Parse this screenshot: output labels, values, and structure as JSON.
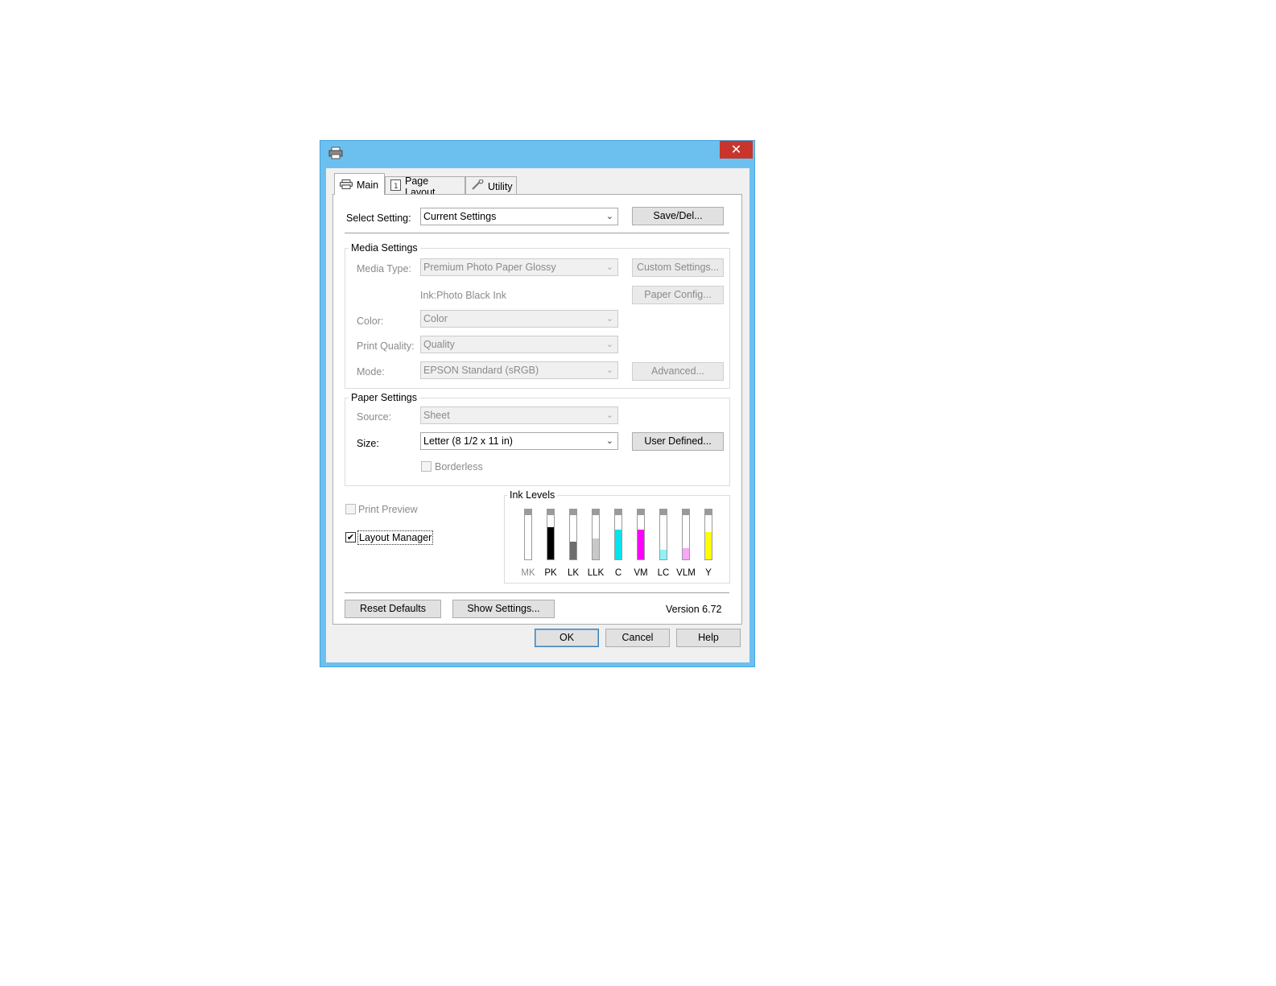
{
  "window": {
    "title_icon": "printer-icon",
    "close_glyph": "✕"
  },
  "tabs": [
    {
      "label": "Main",
      "icon": "printer-icon",
      "active": true
    },
    {
      "label": "Page Layout",
      "icon": "page-icon",
      "active": false
    },
    {
      "label": "Utility",
      "icon": "wrench-icon",
      "active": false
    }
  ],
  "select_setting": {
    "label": "Select Setting:",
    "value": "Current Settings",
    "save_button": "Save/Del..."
  },
  "media_settings": {
    "title": "Media Settings",
    "media_type_label": "Media Type:",
    "media_type_value": "Premium Photo Paper Glossy",
    "custom_settings_button": "Custom Settings...",
    "ink_text": "Ink:Photo Black Ink",
    "paper_config_button": "Paper Config...",
    "color_label": "Color:",
    "color_value": "Color",
    "print_quality_label": "Print Quality:",
    "print_quality_value": "Quality",
    "mode_label": "Mode:",
    "mode_value": "EPSON Standard (sRGB)",
    "advanced_button": "Advanced..."
  },
  "paper_settings": {
    "title": "Paper Settings",
    "source_label": "Source:",
    "source_value": "Sheet",
    "size_label": "Size:",
    "size_value": "Letter (8 1/2 x 11 in)",
    "user_defined_button": "User Defined...",
    "borderless_label": "Borderless",
    "borderless_checked": false
  },
  "print_preview": {
    "label": "Print Preview",
    "checked": false
  },
  "layout_manager": {
    "label": "Layout Manager",
    "checked": true,
    "check_glyph": "✔"
  },
  "ink_levels": {
    "title": "Ink Levels",
    "inks": [
      {
        "name": "MK",
        "level": 0.0,
        "color": "#9a9a9a",
        "inactive": true
      },
      {
        "name": "PK",
        "level": 0.65,
        "color": "#000000",
        "inactive": false
      },
      {
        "name": "LK",
        "level": 0.35,
        "color": "#6e6e6e",
        "inactive": false
      },
      {
        "name": "LLK",
        "level": 0.42,
        "color": "#c8c8c8",
        "inactive": false
      },
      {
        "name": "C",
        "level": 0.6,
        "color": "#00e5ee",
        "inactive": false
      },
      {
        "name": "VM",
        "level": 0.6,
        "color": "#ff00ff",
        "inactive": false
      },
      {
        "name": "LC",
        "level": 0.2,
        "color": "#8ff2f7",
        "inactive": false
      },
      {
        "name": "VLM",
        "level": 0.22,
        "color": "#f7a8f7",
        "inactive": false
      },
      {
        "name": "Y",
        "level": 0.55,
        "color": "#ffff00",
        "inactive": false
      }
    ]
  },
  "bottom": {
    "reset_defaults": "Reset Defaults",
    "show_settings": "Show Settings...",
    "version": "Version 6.72"
  },
  "dialog_buttons": {
    "ok": "OK",
    "cancel": "Cancel",
    "help": "Help"
  },
  "chevron_glyph": "⌄"
}
